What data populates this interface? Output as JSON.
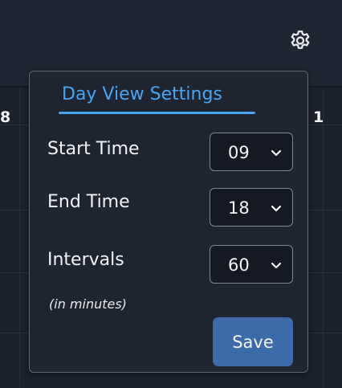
{
  "header": {
    "settings_icon": "gear-icon"
  },
  "calendar": {
    "edge_left_text": "8",
    "edge_right_text": "1"
  },
  "day_view_settings": {
    "title": "Day View Settings",
    "start_time": {
      "label": "Start Time",
      "value": "09"
    },
    "end_time": {
      "label": "End Time",
      "value": "18"
    },
    "intervals": {
      "label": "Intervals",
      "hint": "(in minutes)",
      "value": "60"
    },
    "save_label": "Save"
  },
  "colors": {
    "accent": "#49a4f2",
    "button": "#3d6aa8",
    "panel": "#1e2531",
    "background": "#1c2230"
  }
}
